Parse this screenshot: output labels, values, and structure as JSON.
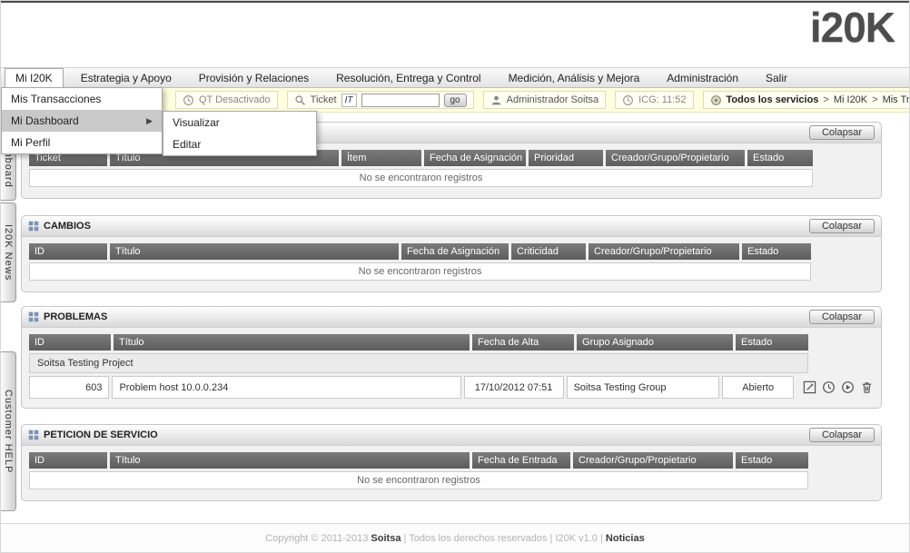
{
  "app": {
    "logo": "i20K"
  },
  "menubar": {
    "items": [
      {
        "label": "Mi I20K"
      },
      {
        "label": "Estrategia y Apoyo"
      },
      {
        "label": "Provisión y Relaciones"
      },
      {
        "label": "Resolución, Entrega y Control"
      },
      {
        "label": "Medición, Análisis y Mejora"
      },
      {
        "label": "Administración"
      },
      {
        "label": "Salir"
      }
    ]
  },
  "menu_dropdown": {
    "items": [
      {
        "label": "Mis Transacciones"
      },
      {
        "label": "Mi Dashboard",
        "arrow": "▶"
      },
      {
        "label": "Mi Perfil"
      }
    ],
    "submenu": [
      {
        "label": "Visualizar"
      },
      {
        "label": "Editar"
      }
    ]
  },
  "toolbar": {
    "qt_label": "QT Desactivado",
    "ticket_label": "Ticket",
    "ticket_type": "IT",
    "ticket_value": "",
    "go_label": "go",
    "user": "Administrador Soitsa",
    "icg": "ICG: 11:52",
    "breadcrumb": {
      "root": "Todos los servicios",
      "sep1": " > ",
      "level1": "Mi I20K",
      "sep2": " > ",
      "level2": "Mis Transacciones"
    }
  },
  "side_tabs": [
    {
      "label": "Dashboard"
    },
    {
      "label": "I20K News"
    },
    {
      "label": "Customer HELP"
    }
  ],
  "sections": [
    {
      "title": "",
      "collapse_label": "Colapsar",
      "columns": [
        "Ticket",
        "Título",
        "Ítem",
        "Fecha de Asignación",
        "Prioridad",
        "Creador/Grupo/Propietario",
        "Estado"
      ],
      "empty_text": "No se encontraron registros"
    },
    {
      "title": "CAMBIOS",
      "collapse_label": "Colapsar",
      "columns": [
        "ID",
        "Título",
        "Fecha de Asignación",
        "Criticidad",
        "Creador/Grupo/Propietario",
        "Estado"
      ],
      "empty_text": "No se encontraron registros"
    },
    {
      "title": "PROBLEMAS",
      "collapse_label": "Colapsar",
      "columns": [
        "ID",
        "Título",
        "Fecha de Alta",
        "Grupo Asignado",
        "Estado"
      ],
      "group_row": "Soitsa Testing Project",
      "row": {
        "id": "603",
        "titulo": "Problem host 10.0.0.234",
        "fecha": "17/10/2012 07:51",
        "grupo": "Soitsa Testing Group",
        "estado": "Abierto"
      }
    },
    {
      "title": "PETICION DE SERVICIO",
      "collapse_label": "Colapsar",
      "columns": [
        "ID",
        "Título",
        "Fecha de Entrada",
        "Creador/Grupo/Propietario",
        "Estado"
      ],
      "empty_text": "No se encontraron registros"
    }
  ],
  "footer": {
    "copyright": "Copyright © 2011-2013 ",
    "brand": "Soitsa",
    "sep1": " | ",
    "rights": "Todos los derechos reservados",
    "sep2": " | ",
    "version": "I20K v1.0",
    "sep3": " | ",
    "news": "Noticias"
  }
}
